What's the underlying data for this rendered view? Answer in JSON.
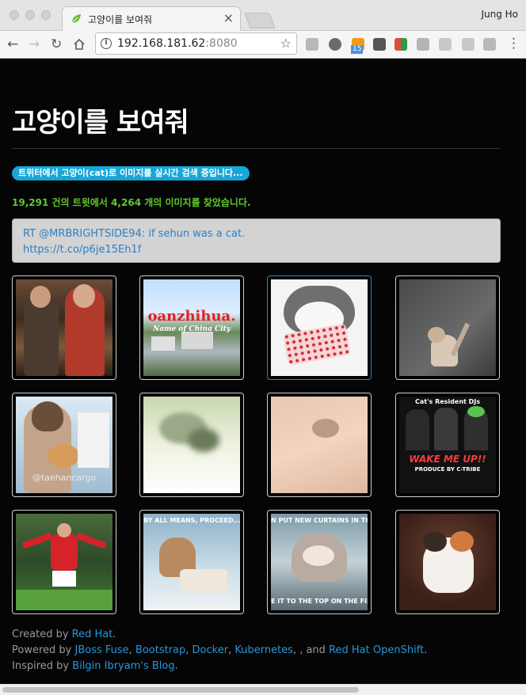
{
  "browser": {
    "tab_title": "고양이를 보여줘",
    "profile_name": "Jung Ho",
    "url_host": "192.168.181.62",
    "url_port": ":8080",
    "extension_badge": "15",
    "icons": [
      "back-icon",
      "forward-icon",
      "reload-icon",
      "home-icon",
      "info-icon",
      "star-icon"
    ]
  },
  "page": {
    "title": "고양이를 보여줘",
    "status_badge": "트위터에서 고양이(cat)로 이미지를 실시간 검색 중입니다...",
    "stats": "19,291 건의 트윗에서 4,264 개의 이미지를 찾았습니다.",
    "tweet_line1": "RT @MRBRIGHTSIDE94: if sehun was a cat.",
    "tweet_link": "https://t.co/p6je15Eh1f",
    "thumbnails": [
      {
        "desc": "people-scene"
      },
      {
        "desc": "city-skyline",
        "caption_top": "oanzhihua.",
        "caption_mid": "Name of China City"
      },
      {
        "desc": "cat-bandana"
      },
      {
        "desc": "cat-sitting-floor"
      },
      {
        "desc": "person-holding-cat",
        "caption_bottom": "@taehancargo"
      },
      {
        "desc": "cat-blurry"
      },
      {
        "desc": "small-cat-blanket"
      },
      {
        "desc": "djs-poster",
        "caption_top": "Cat's Resident DJs",
        "caption_mid": "WAKE ME UP!!",
        "caption_bottom": "PRODUCE BY C-TRIBE"
      },
      {
        "desc": "footballer-celebrating"
      },
      {
        "desc": "cat-in-chair",
        "caption_top": "BY ALL MEANS, PROCEED..."
      },
      {
        "desc": "cat-curtains-meme",
        "caption_top": "N PUT NEW CURTAINS IN THE LIVING",
        "caption_bottom": "E IT TO THE TOP ON THE FIRS"
      },
      {
        "desc": "cat-looking-up"
      }
    ]
  },
  "footer": {
    "created_by": "Created by ",
    "created_by_link": "Red Hat",
    "created_by_end": ".",
    "powered_by": "Powered by ",
    "powered_links": [
      "JBoss Fuse",
      "Bootstrap",
      "Docker",
      "Kubernetes"
    ],
    "powered_mid": ", , and ",
    "powered_last": "Red Hat OpenShift",
    "inspired_by": "Inspired by ",
    "inspired_link": "Bilgin Ibryam's Blog",
    "inspired_end": "."
  },
  "colors": {
    "accent": "#16a7d8",
    "stats": "#5fc82f",
    "link": "#2796d8",
    "background": "#050505"
  }
}
